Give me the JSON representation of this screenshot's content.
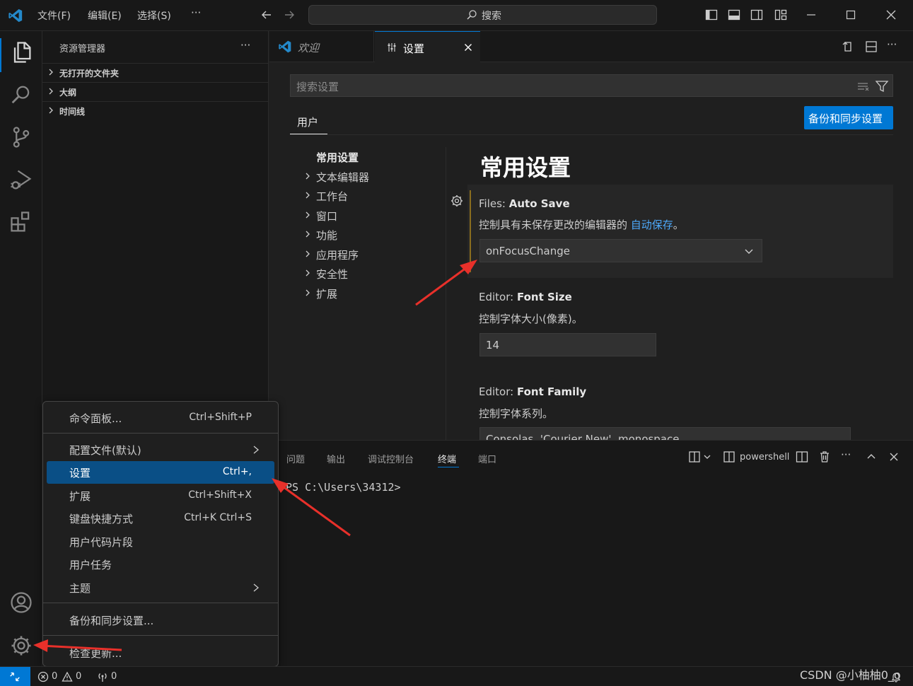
{
  "titlebar": {
    "menus": [
      "文件(F)",
      "编辑(E)",
      "选择(S)"
    ],
    "more": "···",
    "search_label": "搜索"
  },
  "sidebar": {
    "title": "资源管理器",
    "more": "···",
    "sections": [
      "无打开的文件夹",
      "大纲",
      "时间线"
    ]
  },
  "tabs": [
    {
      "label": "欢迎",
      "icon": "vscode-logo-icon"
    },
    {
      "label": "设置",
      "icon": "settings-editor-icon",
      "active": true
    }
  ],
  "settings": {
    "search_placeholder": "搜索设置",
    "scope_tab": "用户",
    "sync_button": "备份和同步设置",
    "toc": [
      "常用设置",
      "文本编辑器",
      "工作台",
      "窗口",
      "功能",
      "应用程序",
      "安全性",
      "扩展"
    ],
    "heading": "常用设置",
    "items": [
      {
        "category": "Files: ",
        "name": "Auto Save",
        "desc": "控制具有未保存更改的编辑器的 ",
        "desc_link": "自动保存",
        "desc_end": "。",
        "value": "onFocusChange"
      },
      {
        "category": "Editor: ",
        "name": "Font Size",
        "desc": "控制字体大小(像素)。",
        "value": "14"
      },
      {
        "category": "Editor: ",
        "name": "Font Family",
        "desc": "控制字体系列。",
        "value": "Consolas, 'Courier New', monospace"
      }
    ]
  },
  "panel": {
    "tabs": [
      "问题",
      "输出",
      "调试控制台",
      "终端",
      "端口"
    ],
    "active_tab": "终端",
    "shell": "powershell",
    "terminal_line": "PS C:\\Users\\34312>"
  },
  "menu": {
    "items": [
      {
        "label": "命令面板...",
        "key": "Ctrl+Shift+P"
      },
      {
        "label": "配置文件(默认)",
        "submenu": true
      },
      {
        "label": "设置",
        "key": "Ctrl+,",
        "highlighted": true
      },
      {
        "label": "扩展",
        "key": "Ctrl+Shift+X"
      },
      {
        "label": "键盘快捷方式",
        "key": "Ctrl+K Ctrl+S"
      },
      {
        "label": "用户代码片段"
      },
      {
        "label": "用户任务"
      },
      {
        "label": "主题",
        "submenu": true
      },
      {
        "label": "备份和同步设置..."
      },
      {
        "label": "检查更新..."
      }
    ]
  },
  "statusbar": {
    "errors": "0",
    "warnings": "0",
    "ports": "0",
    "watermark": "CSDN @小柚柚0_o"
  },
  "colors": {
    "accent": "#0078d4",
    "link": "#4daafc",
    "arrow": "#e8302a",
    "modified_bar": "#8a6d1e"
  }
}
